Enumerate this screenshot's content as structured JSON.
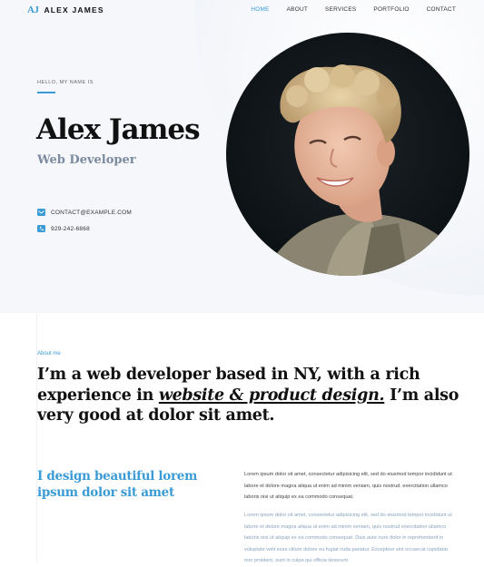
{
  "header": {
    "logo_mark": "AJ",
    "logo_name": "ALEX JAMES",
    "nav": [
      {
        "label": "HOME",
        "active": true
      },
      {
        "label": "ABOUT",
        "active": false
      },
      {
        "label": "SERVICES",
        "active": false
      },
      {
        "label": "PORTFOLIO",
        "active": false
      },
      {
        "label": "CONTACT",
        "active": false
      }
    ]
  },
  "hero": {
    "greeting": "HELLO, MY NAME IS",
    "name": "Alex James",
    "role": "Web Developer",
    "email": "CONTACT@EXAMPLE.COM",
    "phone": "929-242-6868",
    "email_icon": "envelope-icon",
    "phone_icon": "phone-icon"
  },
  "about": {
    "label": "About me",
    "statement_before": "I’m a web developer based in NY, with a rich experience in ",
    "statement_emphasis": "website & product design.",
    "statement_after": " I’m also very good at dolor sit amet.",
    "design_heading": "I design beautiful lorem ipsum dolor sit amet",
    "paragraph_1": "Lorem ipsum dolor sit amet, consectetur adipisicing elit, sed do eiusmod tempor incididunt ut labore et dolore magna aliqua ut enim ad minim veniam, quis nostrud. exercitation ullamco laboris nisi ut aliquip ex ea commodo consequat.",
    "paragraph_2": "Lorem ipsum dolor sit amet, consectetur adipisicing elit, sed do eiusmod tempor incididunt ut labore et dolore magna aliqua ut enim ad minim veniam, quis nostrud exercitation ullamco laboris nisi ut aliquip ex ea commodo consequat. Duis aute irure dolor in reprehenderit in voluptate velit esse cillum dolore eu fugiat nulla pariatur. Excepteur sint occaecat cupidatat non proident, sunt in culpa qui officia deserunt"
  },
  "colors": {
    "accent": "#3a9bd5",
    "muted_heading": "#7b8a9e",
    "hero_bg": "#f5f7fb"
  }
}
